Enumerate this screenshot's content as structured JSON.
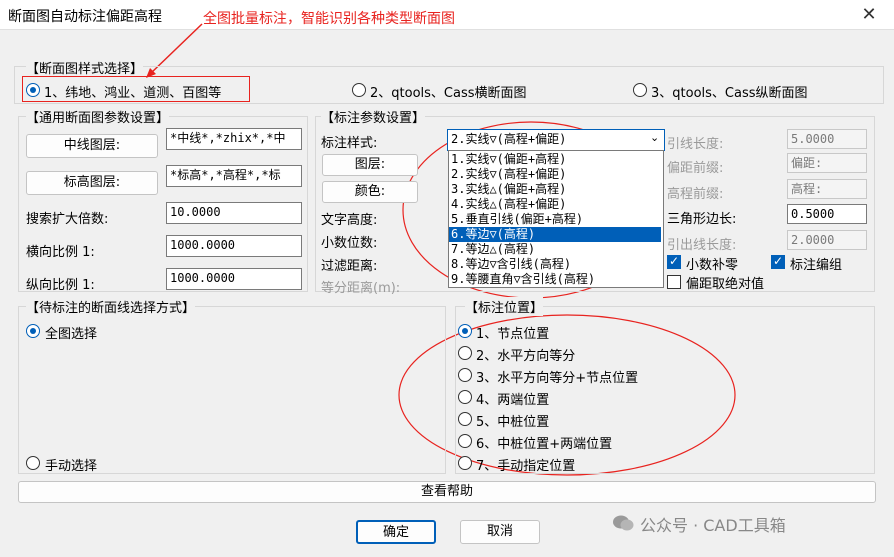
{
  "window": {
    "title": "断面图自动标注偏距高程",
    "annotation": "全图批量标注，智能识别各种类型断面图"
  },
  "style_group": {
    "title": "【断面图样式选择】",
    "options": [
      "1、纬地、鸿业、道测、百图等",
      "2、qtools、Cass横断面图",
      "3、qtools、Cass纵断面图"
    ],
    "selected": 0
  },
  "general_group": {
    "title": "【通用断面图参数设置】",
    "centerline_btn": "中线图层:",
    "centerline_value": "*中线*,*zhix*,*中",
    "elev_btn": "标高图层:",
    "elev_value": "*标高*,*高程*,*标",
    "search_label": "搜索扩大倍数:",
    "search_value": "10.0000",
    "hscale_label": "横向比例 1:",
    "hscale_value": "1000.0000",
    "vscale_label": "纵向比例 1:",
    "vscale_value": "1000.0000"
  },
  "annot_group": {
    "title": "【标注参数设置】",
    "style_label": "标注样式:",
    "style_value": "2.实线▽(高程+偏距)",
    "layer_btn": "图层:",
    "color_btn": "颜色:",
    "text_height_label": "文字高度:",
    "decimals_label": "小数位数:",
    "filter_label": "过滤距离:",
    "equal_dist_label": "等分距离(m):",
    "lead_len_label": "引线长度:",
    "lead_len_value": "5.0000",
    "offset_prefix_label": "偏距前缀:",
    "offset_prefix_value": "偏距:",
    "elev_prefix_label": "高程前缀:",
    "elev_prefix_value": "高程:",
    "tri_side_label": "三角形边长:",
    "tri_side_value": "0.5000",
    "lead_out_label": "引出线长度:",
    "lead_out_value": "2.0000",
    "zero_pad_label": "小数补零",
    "annot_group_label": "标注编组",
    "abs_offset_label": "偏距取绝对值",
    "dropdown_items": [
      "1.实线▽(偏距+高程)",
      "2.实线▽(高程+偏距)",
      "3.实线△(偏距+高程)",
      "4.实线△(高程+偏距)",
      "5.垂直引线(偏距+高程)",
      "6.等边▽(高程)",
      "7.等边△(高程)",
      "8.等边▽含引线(高程)",
      "9.等腰直角▽含引线(高程)"
    ],
    "dropdown_selected": 5
  },
  "select_group": {
    "title": "【待标注的断面线选择方式】",
    "options": [
      "全图选择",
      "手动选择"
    ],
    "selected": 0
  },
  "position_group": {
    "title": "【标注位置】",
    "options": [
      "1、节点位置",
      "2、水平方向等分",
      "3、水平方向等分+节点位置",
      "4、两端位置",
      "5、中桩位置",
      "6、中桩位置+两端位置",
      "7、手动指定位置"
    ],
    "selected": 0
  },
  "help_btn": "查看帮助",
  "ok_btn": "确定",
  "cancel_btn": "取消",
  "watermark": "公众号 · CAD工具箱"
}
